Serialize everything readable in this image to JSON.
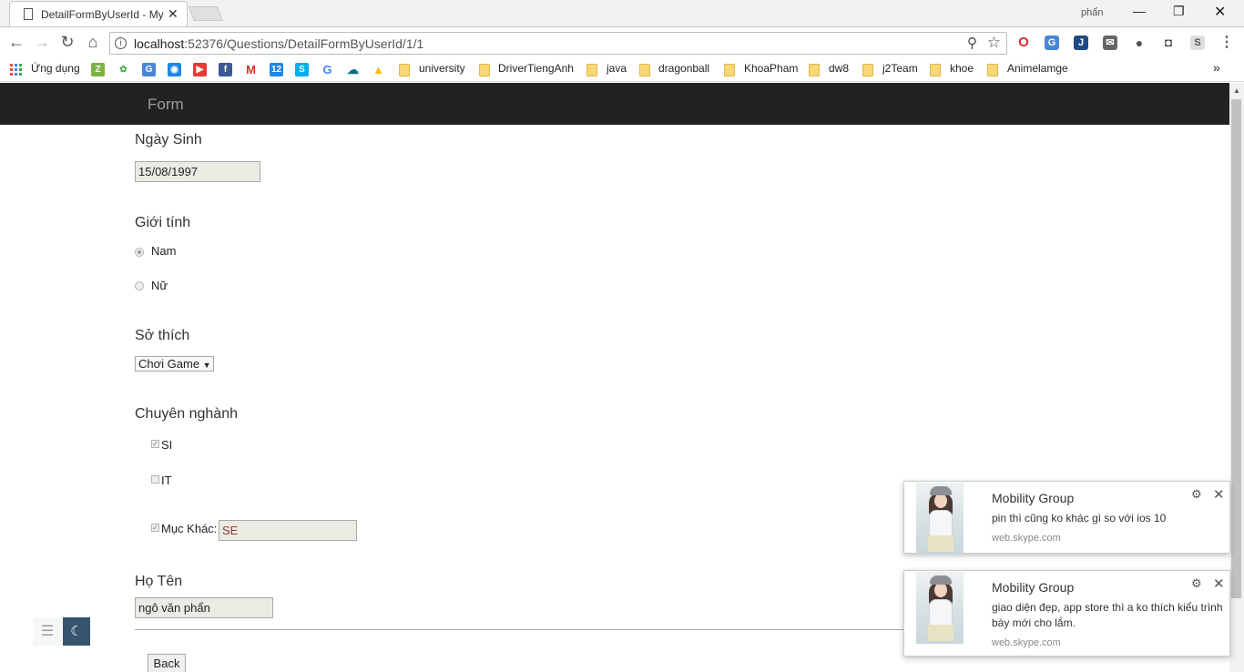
{
  "browser": {
    "tab_title": "DetailFormByUserId - My",
    "profile_name": "phẩn",
    "url_host": "localhost",
    "url_path": ":52376/Questions/DetailFormByUserId/1/1",
    "bookmarks": [
      "Ứng dụng",
      "university",
      "DriverTiengAnh",
      "java",
      "dragonball",
      "KhoaPham",
      "dw8",
      "j2Team",
      "khoe",
      "Animelamge"
    ]
  },
  "page": {
    "brand": "Form",
    "dob_label": "Ngày Sinh",
    "dob_value": "15/08/1997",
    "gender_label": "Giới tính",
    "gender_options": [
      "Nam",
      "Nữ"
    ],
    "gender_selected": "Nam",
    "hobby_label": "Sở thích",
    "hobby_value": "Chơi Game",
    "major_label": "Chuyên nghành",
    "major_options": [
      {
        "label": "SI",
        "checked": true
      },
      {
        "label": "IT",
        "checked": false
      }
    ],
    "other_label": "Mục Khác:",
    "other_checked": true,
    "other_value": "SE",
    "name_label": "Họ Tên",
    "name_value": "ngô văn phẩn",
    "back_button": "Back"
  },
  "notifications": [
    {
      "sender": "Mobility Group",
      "message": "pin thì cũng ko khác gì so với ios 10",
      "source": "web.skype.com"
    },
    {
      "sender": "Mobility Group",
      "message": "giao diện đẹp, app store thì a ko thích kiểu trình bày mới cho lắm.",
      "source": "web.skype.com"
    }
  ],
  "colors": {
    "navbar_bg": "#222222",
    "brand_text": "#9d9d9d",
    "widget_moon": "#36546e"
  }
}
